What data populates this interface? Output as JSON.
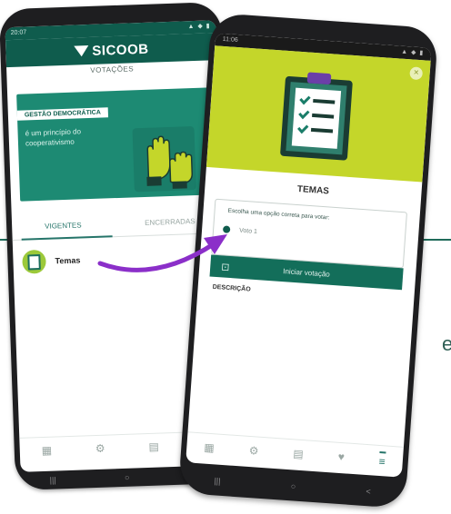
{
  "colors": {
    "primary": "#0f5c4d",
    "banner": "#1d8a73",
    "hero": "#c4d62a",
    "arrow": "#8b2fc9",
    "button": "#136e5a"
  },
  "edge_text": "e",
  "phone1": {
    "status_time": "20:07",
    "status_icons": "▲ ◆ ▮",
    "app_name": "SICOOB",
    "section_title": "VOTAÇÕES",
    "banner": {
      "tag": "GESTÃO DEMOCRÁTICA",
      "text": "é um princípio do cooperativismo"
    },
    "tabs": [
      {
        "label": "VIGENTES"
      },
      {
        "label": "ENCERRADAS"
      }
    ],
    "list": [
      {
        "label": "Temas",
        "icon": "clipboard-icon"
      }
    ],
    "nav_icons": [
      "▦",
      "⚙",
      "▤",
      "♥"
    ],
    "soft_keys": [
      "|||",
      "○",
      "<"
    ]
  },
  "phone2": {
    "status_time": "11:06",
    "status_icons": "▲ ◆ ▮",
    "close_label": "×",
    "title": "TEMAS",
    "question": "Escolha uma opção correta para votar:",
    "option": " Voto 1",
    "button_label": "Iniciar votação",
    "description_label": "DESCRIÇÃO",
    "nav_icons": [
      "▦",
      "⚙",
      "▤",
      "♥",
      "≡"
    ],
    "soft_keys": [
      "|||",
      "○",
      "<"
    ]
  }
}
